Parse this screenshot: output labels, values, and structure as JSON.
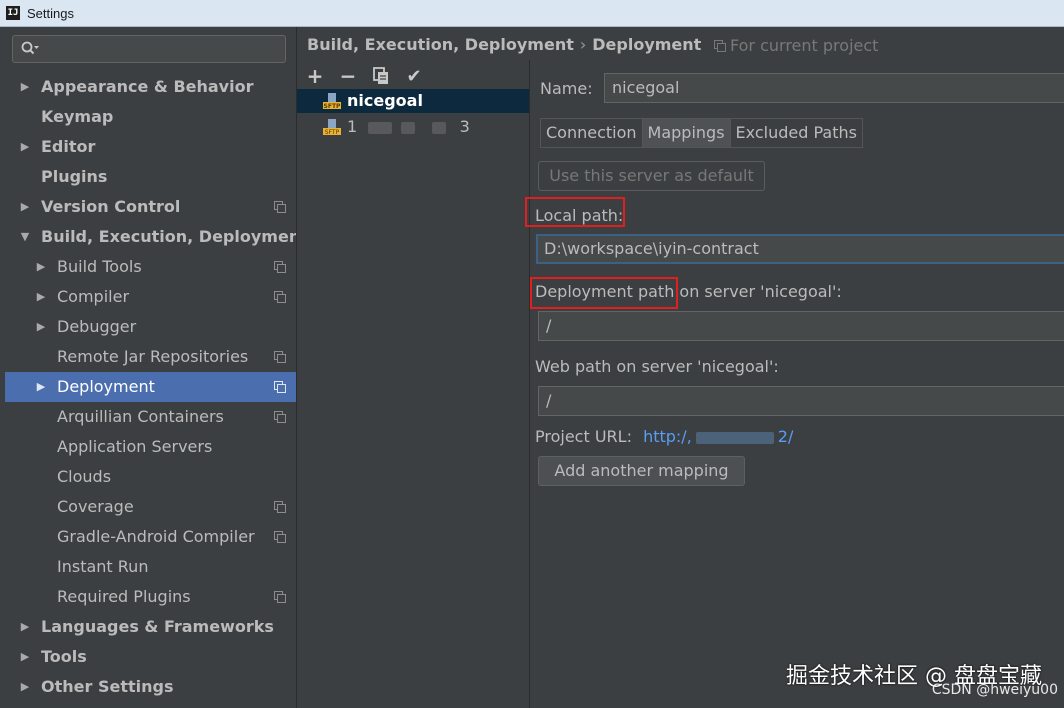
{
  "window": {
    "title": "Settings",
    "app_icon_text": "IJ"
  },
  "search": {
    "placeholder": ""
  },
  "sidebar": {
    "items": [
      {
        "label": "Appearance & Behavior",
        "level": 0,
        "bold": true,
        "arrow": "right",
        "has_config_icon": false
      },
      {
        "label": "Keymap",
        "level": 0,
        "bold": true,
        "arrow": "",
        "has_config_icon": false
      },
      {
        "label": "Editor",
        "level": 0,
        "bold": true,
        "arrow": "right",
        "has_config_icon": false
      },
      {
        "label": "Plugins",
        "level": 0,
        "bold": true,
        "arrow": "",
        "has_config_icon": false
      },
      {
        "label": "Version Control",
        "level": 0,
        "bold": true,
        "arrow": "right",
        "has_config_icon": true
      },
      {
        "label": "Build, Execution, Deployment",
        "level": 0,
        "bold": true,
        "arrow": "down",
        "has_config_icon": false
      },
      {
        "label": "Build Tools",
        "level": 1,
        "bold": false,
        "arrow": "right",
        "has_config_icon": true
      },
      {
        "label": "Compiler",
        "level": 1,
        "bold": false,
        "arrow": "right",
        "has_config_icon": true
      },
      {
        "label": "Debugger",
        "level": 1,
        "bold": false,
        "arrow": "right",
        "has_config_icon": false
      },
      {
        "label": "Remote Jar Repositories",
        "level": 1,
        "bold": false,
        "arrow": "",
        "has_config_icon": true
      },
      {
        "label": "Deployment",
        "level": 1,
        "bold": false,
        "arrow": "right",
        "has_config_icon": true,
        "selected": true
      },
      {
        "label": "Arquillian Containers",
        "level": 1,
        "bold": false,
        "arrow": "",
        "has_config_icon": true
      },
      {
        "label": "Application Servers",
        "level": 1,
        "bold": false,
        "arrow": "",
        "has_config_icon": false
      },
      {
        "label": "Clouds",
        "level": 1,
        "bold": false,
        "arrow": "",
        "has_config_icon": false
      },
      {
        "label": "Coverage",
        "level": 1,
        "bold": false,
        "arrow": "",
        "has_config_icon": true
      },
      {
        "label": "Gradle-Android Compiler",
        "level": 1,
        "bold": false,
        "arrow": "",
        "has_config_icon": true
      },
      {
        "label": "Instant Run",
        "level": 1,
        "bold": false,
        "arrow": "",
        "has_config_icon": false
      },
      {
        "label": "Required Plugins",
        "level": 1,
        "bold": false,
        "arrow": "",
        "has_config_icon": true
      },
      {
        "label": "Languages & Frameworks",
        "level": 0,
        "bold": true,
        "arrow": "right",
        "has_config_icon": false
      },
      {
        "label": "Tools",
        "level": 0,
        "bold": true,
        "arrow": "right",
        "has_config_icon": false
      },
      {
        "label": "Other Settings",
        "level": 0,
        "bold": true,
        "arrow": "right",
        "has_config_icon": false
      }
    ]
  },
  "header": {
    "breadcrumb_parent": "Build, Execution, Deployment",
    "breadcrumb_separator": "›",
    "breadcrumb_current": "Deployment",
    "scope_label": "For current project"
  },
  "servers": {
    "toolbar": {
      "add": "+",
      "remove": "−",
      "copy": "copy-icon",
      "apply": "✔"
    },
    "items": [
      {
        "name": "nicegoal",
        "selected": true
      },
      {
        "name_prefix": "1",
        "name_suffix": "3",
        "selected": false
      }
    ]
  },
  "details": {
    "name_label": "Name:",
    "name_value": "nicegoal",
    "tabs": [
      "Connection",
      "Mappings",
      "Excluded Paths"
    ],
    "active_tab": "Mappings",
    "default_button": "Use this server as default",
    "local_path_label": "Local path:",
    "local_path_value": "D:\\workspace\\iyin-contract",
    "deployment_path_label_part1": "Deployment path",
    "deployment_path_label_part2": " on server 'nicegoal':",
    "deployment_path_value": "/",
    "web_path_label": "Web path on server 'nicegoal':",
    "web_path_value": "/",
    "project_url_label": "Project URL:",
    "project_url_prefix": "http:/,",
    "project_url_suffix": "2/",
    "add_mapping_button": "Add another mapping"
  },
  "watermark": {
    "line1": "掘金技术社区 @ 盘盘宝藏",
    "line2": "CSDN @hweiyu00"
  },
  "colors": {
    "selection": "#4b6eaf",
    "link": "#589df6",
    "highlight_box": "#e02020",
    "background": "#3c3f41"
  }
}
